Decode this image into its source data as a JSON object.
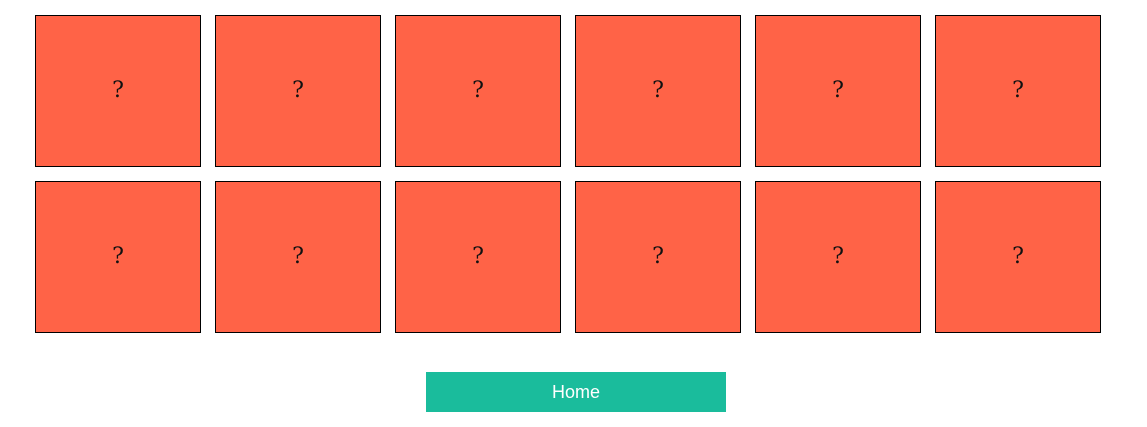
{
  "board": {
    "cards": [
      {
        "symbol": "?"
      },
      {
        "symbol": "?"
      },
      {
        "symbol": "?"
      },
      {
        "symbol": "?"
      },
      {
        "symbol": "?"
      },
      {
        "symbol": "?"
      },
      {
        "symbol": "?"
      },
      {
        "symbol": "?"
      },
      {
        "symbol": "?"
      },
      {
        "symbol": "?"
      },
      {
        "symbol": "?"
      },
      {
        "symbol": "?"
      }
    ]
  },
  "home_button": {
    "label": "Home"
  },
  "colors": {
    "card_back": "#ff6347",
    "button": "#1abc9c",
    "button_text": "#ffffff"
  }
}
